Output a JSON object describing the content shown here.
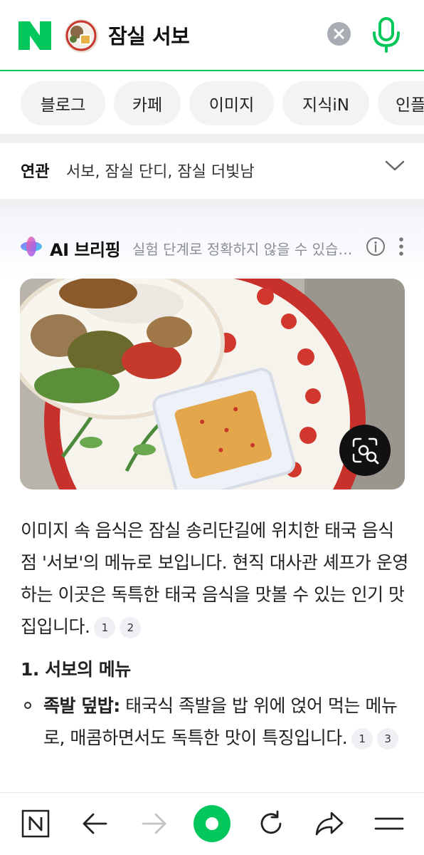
{
  "search": {
    "query": "잠실 서보"
  },
  "tabs": [
    {
      "label": "블로그"
    },
    {
      "label": "카페"
    },
    {
      "label": "이미지"
    },
    {
      "label": "지식iN"
    },
    {
      "label": "인플"
    }
  ],
  "related": {
    "title": "연관",
    "text": "서보, 잠실 단디, 잠실 더빛남"
  },
  "ai_briefing": {
    "title": "AI 브리핑",
    "notice": "실험 단계로 정확하지 않을 수 있습니다",
    "paragraph": "이미지 속 음식은 잠실 송리단길에 위치한 태국 음식점 '서보'의 메뉴로 보입니다. 현직 대사관 셰프가 운영하는 이곳은 독특한 태국 음식을 맛볼 수 있는 인기 맛집입니다.",
    "paragraph_citations": [
      "1",
      "2"
    ],
    "section_heading": "1. 서보의 메뉴",
    "bullet": {
      "term": "족발 덮밥:",
      "text": " 태국식 족발을 밥 위에 얹어 먹는 메뉴로, 매콤하면서도 독특한 맛이 특징입니다.",
      "citations": [
        "1",
        "3"
      ]
    }
  },
  "toolbar": {
    "items": [
      "home-icon",
      "back-icon",
      "forward-icon",
      "green-dot-icon",
      "refresh-icon",
      "share-icon",
      "menu-icon"
    ]
  },
  "colors": {
    "brand_green": "#03c75a",
    "chip_bg": "#f1f3f5",
    "muted_text": "#8a8f95"
  }
}
